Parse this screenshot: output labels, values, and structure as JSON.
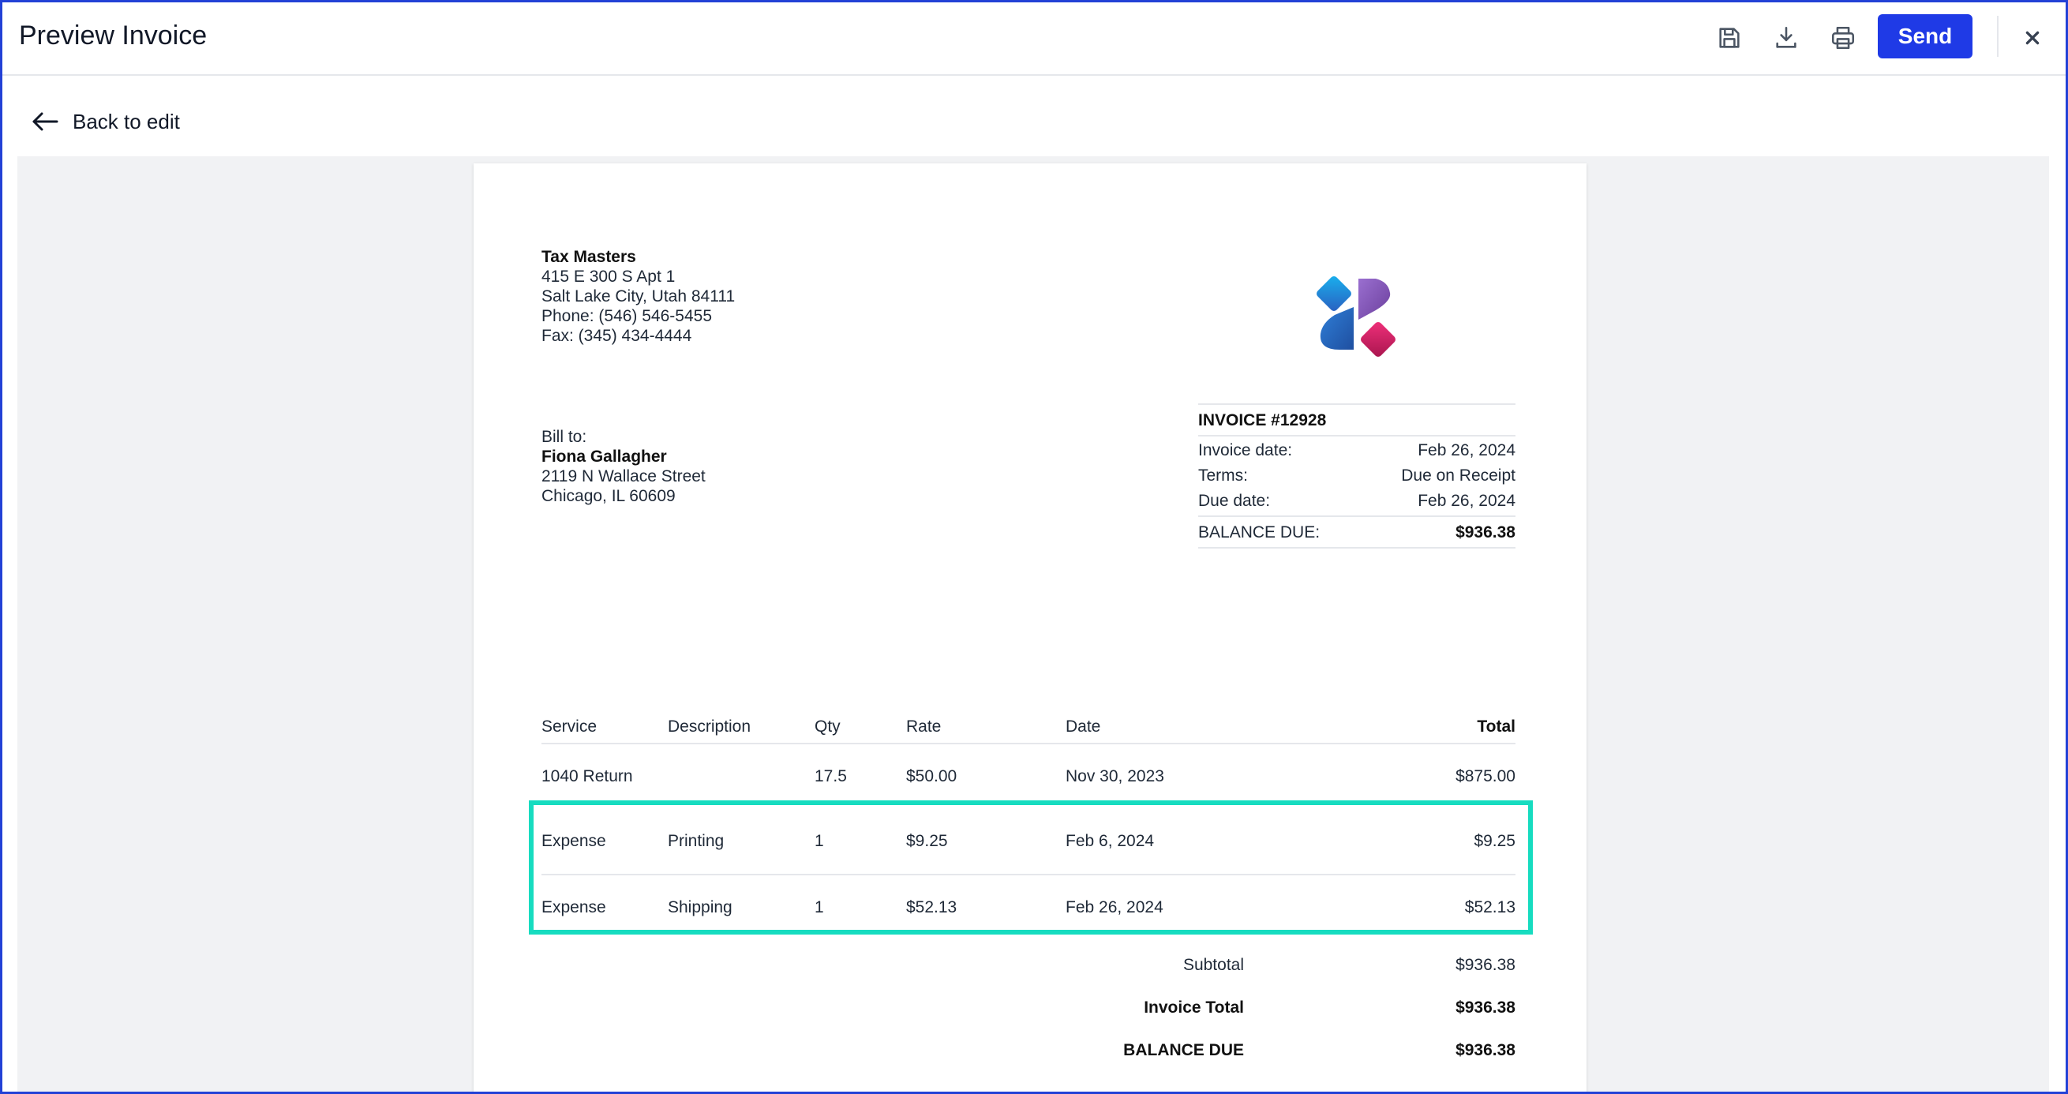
{
  "header": {
    "title": "Preview Invoice",
    "send_label": "Send",
    "icons": [
      "save-icon",
      "download-icon",
      "print-icon",
      "close-icon"
    ]
  },
  "back_label": "Back to edit",
  "company": {
    "name": "Tax Masters",
    "address1": "415 E 300 S Apt 1",
    "address2": "Salt Lake City, Utah 84111",
    "phone": "Phone: (546) 546-5455",
    "fax": "Fax: (345) 434-4444"
  },
  "bill_to": {
    "label": "Bill to:",
    "name": "Fiona Gallagher",
    "address1": "2119 N Wallace Street",
    "address2": "Chicago, IL 60609"
  },
  "invoice": {
    "number": "INVOICE #12928",
    "rows": [
      {
        "label": "Invoice date:",
        "value": "Feb 26, 2024"
      },
      {
        "label": "Terms:",
        "value": "Due on Receipt"
      },
      {
        "label": "Due date:",
        "value": "Feb 26, 2024"
      }
    ],
    "balance_label": "BALANCE DUE:",
    "balance_value": "$936.38"
  },
  "table": {
    "columns": [
      "Service",
      "Description",
      "Qty",
      "Rate",
      "Date",
      "Total"
    ],
    "rows": [
      [
        "1040 Return",
        "",
        "17.5",
        "$50.00",
        "Nov 30, 2023",
        "$875.00"
      ],
      [
        "Expense",
        "Printing",
        "1",
        "$9.25",
        "Feb 6, 2024",
        "$9.25"
      ],
      [
        "Expense",
        "Shipping",
        "1",
        "$52.13",
        "Feb 26, 2024",
        "$52.13"
      ]
    ]
  },
  "totals": {
    "subtotal_label": "Subtotal",
    "subtotal_value": "$936.38",
    "invoice_total_label": "Invoice Total",
    "invoice_total_value": "$936.38",
    "balance_due_label": "BALANCE DUE",
    "balance_due_value": "$936.38"
  },
  "colors": {
    "accent": "#1f3ae6",
    "highlight": "#17dcc0",
    "logo_blue": "#1aa3e8",
    "logo_purple": "#8e5cc4",
    "logo_pink": "#e0246f"
  }
}
